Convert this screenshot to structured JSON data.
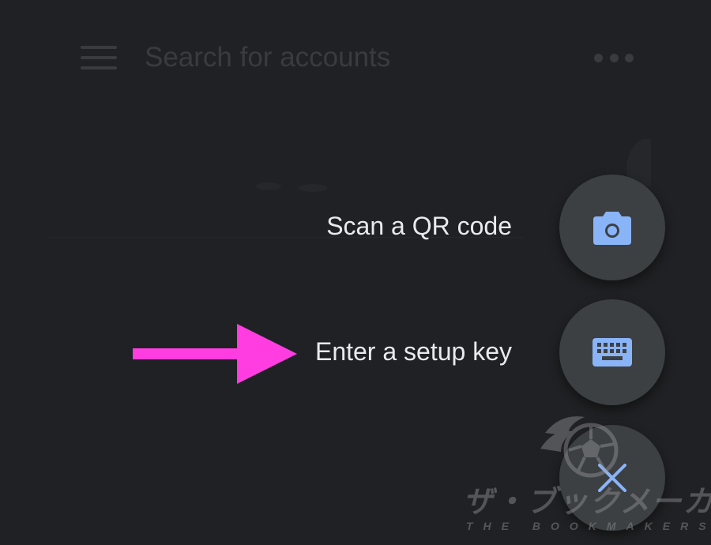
{
  "app_bar": {
    "search_placeholder": "Search for accounts",
    "menu_icon": "hamburger-menu-icon",
    "more_icon": "more-horizontal-icon"
  },
  "speed_dial": {
    "scan_qr": {
      "label": "Scan a QR code",
      "icon": "camera-icon"
    },
    "setup_key": {
      "label": "Enter a setup key",
      "icon": "keyboard-icon"
    },
    "close": {
      "icon": "close-icon"
    }
  },
  "annotation": {
    "icon": "arrow-right-icon",
    "color": "#ff3de0"
  },
  "watermark": {
    "title": "ザ・ブックメーカーズ",
    "subtitle": "THE BOOKMAKERS"
  },
  "colors": {
    "background": "#202124",
    "fab_background": "#3c4043",
    "icon_accent": "#8ab4f8",
    "label_text": "#e8eaed",
    "arrow": "#ff3de0"
  }
}
